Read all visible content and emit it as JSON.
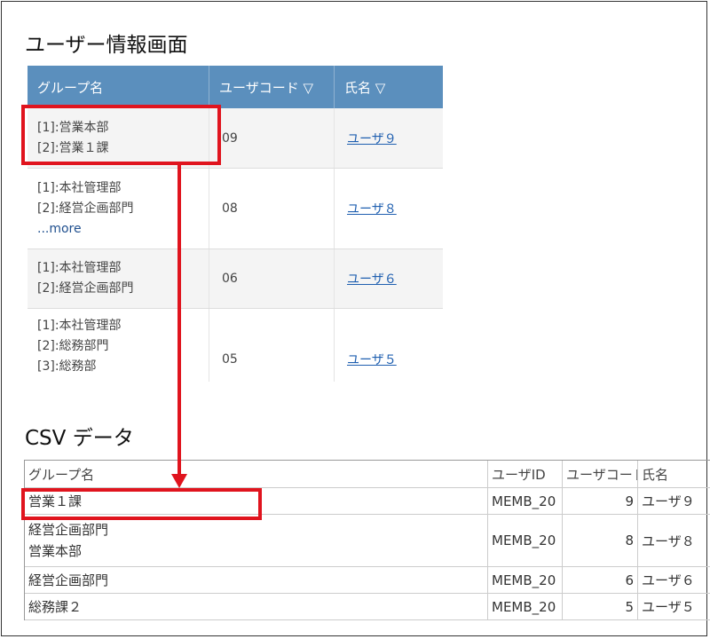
{
  "titles": {
    "user_info": "ユーザー情報画面",
    "csv": "CSV データ"
  },
  "user_table": {
    "headers": [
      "グループ名",
      "ユーザコード ▽",
      "氏名 ▽"
    ],
    "rows": [
      {
        "groups": [
          "[1]:営業本部",
          "[2]:営業１課"
        ],
        "more": "",
        "code": "09",
        "name": "ユーザ９"
      },
      {
        "groups": [
          "[1]:本社管理部",
          "[2]:経営企画部門"
        ],
        "more": "...more",
        "code": "08",
        "name": "ユーザ８"
      },
      {
        "groups": [
          "[1]:本社管理部",
          "[2]:経営企画部門"
        ],
        "more": "",
        "code": "06",
        "name": "ユーザ６"
      },
      {
        "groups": [
          "[1]:本社管理部",
          "[2]:総務部門",
          "[3]:総務部"
        ],
        "more": "",
        "code": "05",
        "name": "ユーザ５"
      }
    ]
  },
  "csv_table": {
    "headers": [
      "グループ名",
      "ユーザID",
      "ユーザコード",
      "氏名"
    ],
    "rows": [
      {
        "group": [
          "営業１課"
        ],
        "id": "MEMB_20",
        "code": "9",
        "name": "ユーザ９"
      },
      {
        "group": [
          "経営企画部門",
          "営業本部"
        ],
        "id": "MEMB_20",
        "code": "8",
        "name": "ユーザ８"
      },
      {
        "group": [
          "経営企画部門"
        ],
        "id": "MEMB_20",
        "code": "6",
        "name": "ユーザ６"
      },
      {
        "group": [
          "総務課２"
        ],
        "id": "MEMB_20",
        "code": "5",
        "name": "ユーザ５"
      }
    ]
  },
  "colors": {
    "header_bg": "#5b8fbd",
    "highlight": "#e0141e",
    "link": "#1f5fb0"
  }
}
